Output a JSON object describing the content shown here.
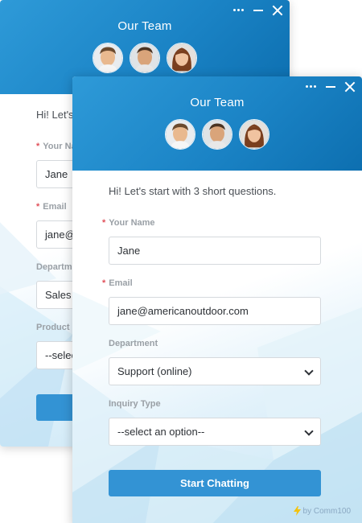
{
  "colors": {
    "header_start": "#2e9ad8",
    "header_end": "#0d6fb0",
    "button": "#3393d4",
    "required_mark": "#e0505a",
    "label": "#9aa0a6",
    "powered_bolt": "#f4c20d"
  },
  "back_window": {
    "title": "Our Team",
    "greeting": "Hi! Let's",
    "name_label": "Your Nam",
    "name_value": "Jane",
    "email_label": "Email",
    "email_value": "jane@",
    "department_label": "Departm",
    "department_value": "Sales",
    "product_label": "Product C",
    "product_value": "--selec"
  },
  "front_window": {
    "title": "Our Team",
    "greeting": "Hi! Let's start with 3 short questions.",
    "fields": [
      {
        "label": "Your Name",
        "required": true,
        "value": "Jane",
        "kind": "input"
      },
      {
        "label": "Email",
        "required": true,
        "value": "jane@americanoutdoor.com",
        "kind": "input"
      },
      {
        "label": "Department",
        "required": false,
        "value": "Support (online)",
        "kind": "select"
      },
      {
        "label": "Inquiry Type",
        "required": false,
        "value": "--select an option--",
        "kind": "select"
      }
    ],
    "required_mark": "*",
    "start_button": "Start Chatting",
    "powered_by": "by Comm100"
  },
  "icons": {
    "more": "more-icon",
    "minimize": "minimize-icon",
    "close": "close-icon",
    "select": "chevron-down-icon",
    "powered": "bolt-icon"
  }
}
